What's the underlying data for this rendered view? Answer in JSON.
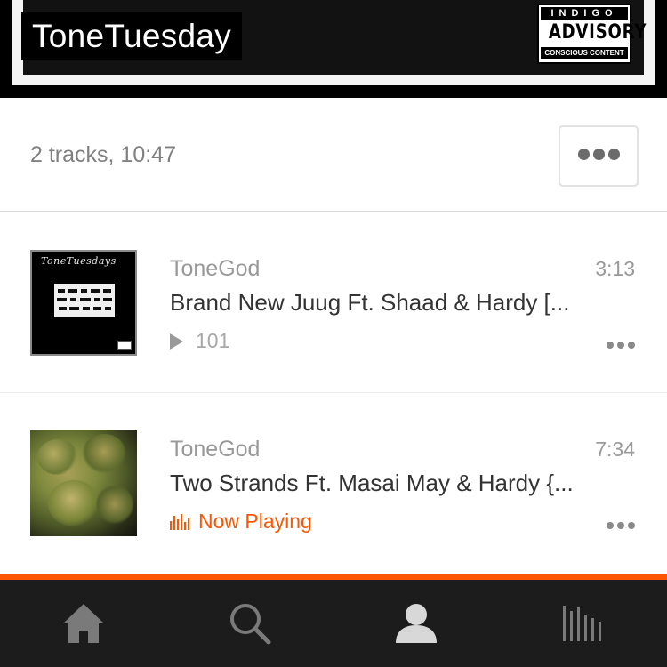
{
  "playlist": {
    "title": "ToneTuesday",
    "advisory": {
      "top": "INDIGO",
      "middle": "ADVISORY",
      "bottom": "CONSCIOUS CONTENT"
    },
    "summary": "2 tracks, 10:47",
    "more_icon": "more-dots-icon"
  },
  "tracks": [
    {
      "artist": "ToneGod",
      "title": "Brand New Juug Ft. Shaad & Hardy [...",
      "duration": "3:13",
      "play_count": "101",
      "artwork_caption": "ToneTuesdays",
      "state": "idle"
    },
    {
      "artist": "ToneGod",
      "title": "Two Strands Ft. Masai May & Hardy {...",
      "duration": "7:34",
      "status": "Now Playing",
      "state": "playing"
    }
  ],
  "tabbar": {
    "items": [
      {
        "icon": "home-icon",
        "active": false
      },
      {
        "icon": "search-icon",
        "active": false
      },
      {
        "icon": "profile-icon",
        "active": true
      },
      {
        "icon": "collection-icon",
        "active": false
      }
    ]
  },
  "colors": {
    "accent": "#ff5500",
    "tab_background": "#1c1c1c",
    "tab_icon": "#7a7a7a",
    "tab_icon_active": "#d8d8d8"
  }
}
